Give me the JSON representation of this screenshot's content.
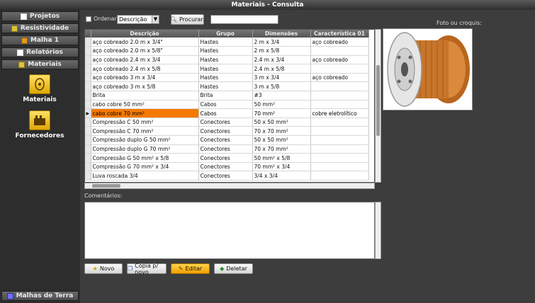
{
  "window": {
    "title": "Materiais - Consulta"
  },
  "sidebar": {
    "items": [
      {
        "label": "Projetos"
      },
      {
        "label": "Resistividade"
      },
      {
        "label": "Malha 1"
      },
      {
        "label": "Relatórios"
      },
      {
        "label": "Materiais"
      }
    ],
    "big_items": [
      {
        "label": "Materiais"
      },
      {
        "label": "Fornecedores"
      }
    ],
    "bottom_item": {
      "label": "Malhas de Terra"
    }
  },
  "toolbar": {
    "order_label": "Ordenar:",
    "order_value": "Descrição",
    "search_button": "Procurar:",
    "search_value": ""
  },
  "photo_label": "Foto ou croquis:",
  "table": {
    "columns": [
      "Descrição",
      "Grupo",
      "Dimensões",
      "Característica 01"
    ],
    "rows": [
      [
        "aço cobreado 2.0 m x 3/4\"",
        "Hastes",
        "2 m x 3/4",
        "aço cobreado"
      ],
      [
        "aço cobreado 2.0 m x 5/8\"",
        "Hastes",
        "2 m x 5/8",
        ""
      ],
      [
        "aço cobreado 2.4 m x 3/4",
        "Hastes",
        "2.4 m x 3/4",
        "aço cobreado"
      ],
      [
        "aço cobreado 2.4 m x 5/8",
        "Hastes",
        "2.4 m x 5/8",
        ""
      ],
      [
        "aço cobreado 3 m x 3/4",
        "Hastes",
        "3 m x 3/4",
        "aço cobreado"
      ],
      [
        "aço cobreado 3 m x 5/8",
        "Hastes",
        "3 m x 5/8",
        ""
      ],
      [
        "Brita",
        "Brita",
        "#3",
        ""
      ],
      [
        "cabo cobre 50 mm²",
        "Cabos",
        "50 mm²",
        ""
      ],
      [
        "cabo cobre 70 mm²",
        "Cabos",
        "70 mm²",
        "cobre eletrolítico"
      ],
      [
        "Compressão C 50 mm²",
        "Conectores",
        "50 x 50 mm²",
        ""
      ],
      [
        "Compressão C 70 mm²",
        "Conectores",
        "70 x 70 mm²",
        ""
      ],
      [
        "Compressão duplo G 50 mm²",
        "Conectores",
        "50 x 50 mm²",
        ""
      ],
      [
        "Compressão duplo G 70 mm²",
        "Conectores",
        "70 x 70 mm²",
        ""
      ],
      [
        "Compressão G 50 mm² x 5/8",
        "Conectores",
        "50 mm² x 5/8",
        ""
      ],
      [
        "Compressão G 70 mm² x 3/4",
        "Conectores",
        "70 mm² x 3/4",
        ""
      ],
      [
        "Luva roscada 3/4",
        "Conectores",
        "3/4 x 3/4",
        ""
      ]
    ],
    "selected_row": 8
  },
  "comments_label": "Comentários:",
  "buttons": {
    "novo": "Novo",
    "copia": "Copia p/ novo",
    "editar": "Editar",
    "deletar": "Deletar"
  }
}
